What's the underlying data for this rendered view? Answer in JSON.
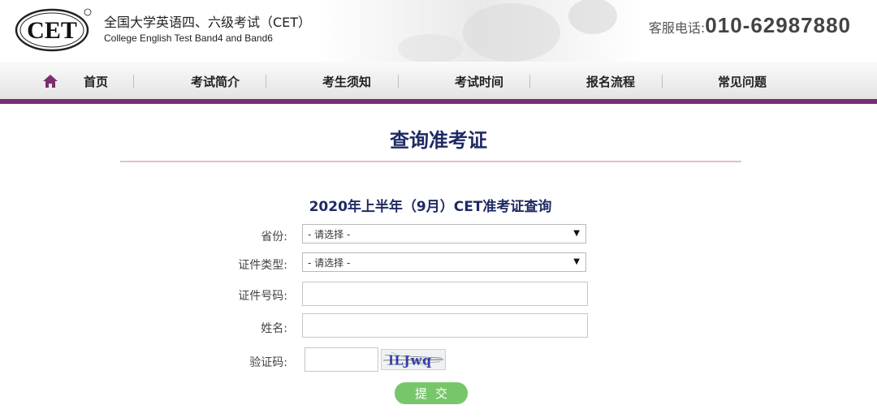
{
  "header": {
    "logo_text": "CET",
    "title": "全国大学英语四、六级考试（CET）",
    "subtitle": "College English Test Band4 and Band6",
    "hotline_label": "客服电话:",
    "hotline_number": "010-62987880"
  },
  "nav": {
    "items": [
      {
        "label": "首页"
      },
      {
        "label": "考试简介"
      },
      {
        "label": "考生须知"
      },
      {
        "label": "考试时间"
      },
      {
        "label": "报名流程"
      },
      {
        "label": "常见问题"
      }
    ]
  },
  "page": {
    "title": "查询准考证"
  },
  "form": {
    "title": "2020年上半年（9月）CET准考证查询",
    "province": {
      "label": "省份:",
      "selected": "- 请选择 -"
    },
    "id_type": {
      "label": "证件类型:",
      "selected": "- 请选择 -"
    },
    "id_number": {
      "label": "证件号码:",
      "value": "",
      "placeholder": ""
    },
    "name": {
      "label": "姓名:",
      "value": "",
      "placeholder": ""
    },
    "captcha": {
      "label": "验证码:",
      "value": "",
      "image_text": "lLJwq"
    },
    "submit_label": "提交"
  },
  "icons": {
    "home": "home-icon",
    "select_arrow": "triangle-down-icon"
  },
  "colors": {
    "accent": "#7b2d72",
    "title": "#1f2a63",
    "rule": "#e2bcd8",
    "submit": "#77c76a"
  }
}
